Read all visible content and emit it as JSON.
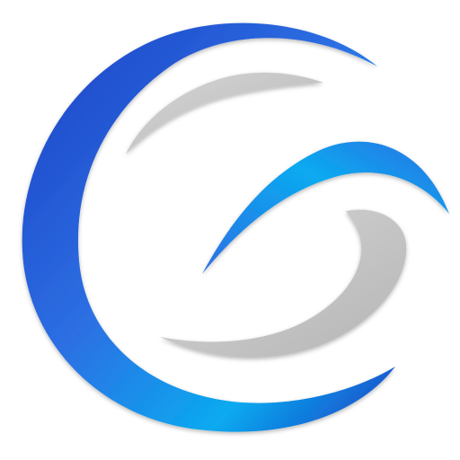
{
  "logo": {
    "icon": "swirl-logo-icon",
    "colors": {
      "background": "#ffffff",
      "blue_dark": "#1a3fc4",
      "blue_mid": "#2d6fe3",
      "blue_light": "#0aaaf0",
      "gray_light": "#d6d6d6",
      "gray_dark": "#b5b5b5"
    }
  }
}
